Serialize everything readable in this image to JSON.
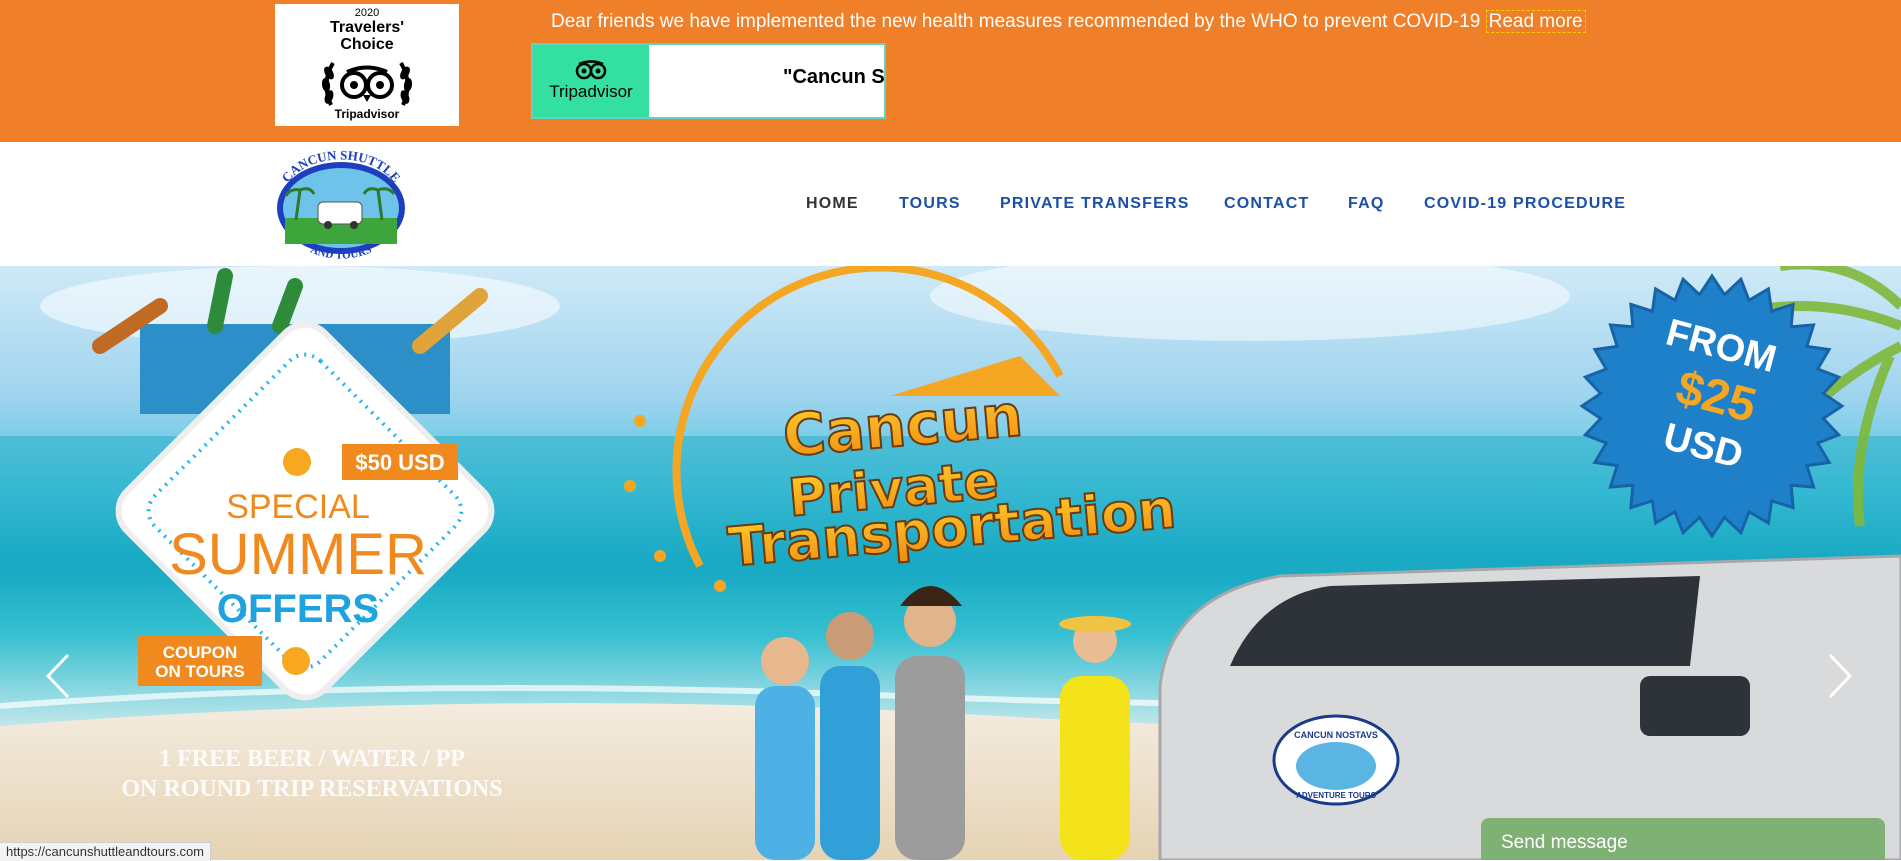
{
  "topbar": {
    "badge": {
      "year": "2020",
      "title_line1": "Travelers'",
      "title_line2": "Choice",
      "brand": "Tripadvisor"
    },
    "notice": "Dear friends we have implemented the new health measures recommended by the WHO to prevent COVID-19 ",
    "read_more": "Read more",
    "widget": {
      "brand": "Tripadvisor",
      "quote": "\"Cancun Sh"
    },
    "color": "#F07F2A"
  },
  "header": {
    "logo": {
      "line1": "CANCUN SHUTTLE",
      "line2": "AND TOURS"
    },
    "nav": [
      "HOME",
      "TOURS",
      "PRIVATE TRANSFERS",
      "CONTACT",
      "FAQ",
      "COVID-19 PROCEDURE"
    ],
    "active": "HOME"
  },
  "hero": {
    "promo": {
      "price": "$50 USD",
      "special": "SPECIAL",
      "summer": "SUMMER",
      "offers": "OFFERS",
      "coupon1": "COUPON",
      "coupon2": "ON TOURS"
    },
    "promo_footer1": "1 FREE BEER / WATER / PP",
    "promo_footer2": "ON ROUND TRIP RESERVATIONS",
    "title1": "Cancun",
    "title2": "Private",
    "title3": "Transportation",
    "badge": {
      "from": "FROM",
      "price": "$25",
      "currency": "USD"
    },
    "van_badge": {
      "top": "CANCUN NOSTAVS",
      "bottom": "ADVENTURE TOURS"
    }
  },
  "status_url": "https://cancunshuttleandtours.com",
  "chat": {
    "label": "Send message"
  }
}
